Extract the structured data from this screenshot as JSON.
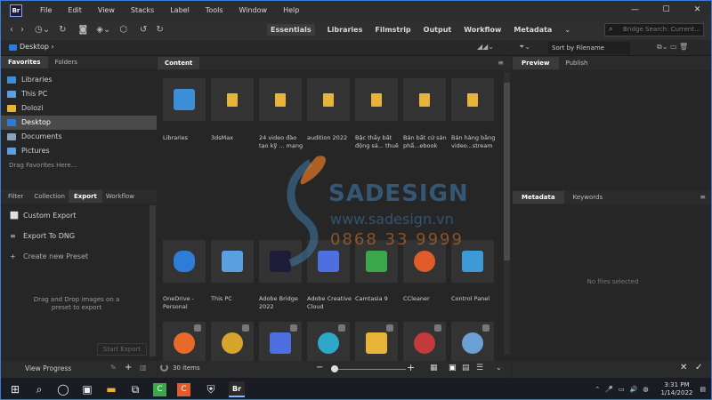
{
  "menu": {
    "items": [
      "File",
      "Edit",
      "View",
      "Stacks",
      "Label",
      "Tools",
      "Window",
      "Help"
    ],
    "logo": "Br"
  },
  "window": {
    "minimize": "—",
    "maximize": "☐",
    "close": "✕"
  },
  "toolbar": {
    "workspaces": [
      {
        "label": "Essentials",
        "active": true
      },
      {
        "label": "Libraries"
      },
      {
        "label": "Filmstrip"
      },
      {
        "label": "Output"
      },
      {
        "label": "Workflow"
      },
      {
        "label": "Metadata"
      }
    ],
    "workspace_menu": "⌄",
    "search_placeholder": "Bridge Search: Current..."
  },
  "path": {
    "label": "Desktop",
    "chevron": "›",
    "sort": "Sort by Filename"
  },
  "left": {
    "tabs": [
      "Favorites",
      "Folders"
    ],
    "favorites": [
      {
        "label": "Libraries",
        "color": "#3c8fd6"
      },
      {
        "label": "This PC",
        "color": "#5aa0e0"
      },
      {
        "label": "Dolozi",
        "color": "#e8b437"
      },
      {
        "label": "Desktop",
        "color": "#2c7cd6",
        "selected": true
      },
      {
        "label": "Documents",
        "color": "#8aa4c0"
      },
      {
        "label": "Pictures",
        "color": "#5aa0e0"
      }
    ],
    "drag_hint": "Drag Favorites Here...",
    "lower_tabs": [
      "Filter",
      "Collection",
      "Export",
      "Workflow"
    ],
    "export_items": [
      {
        "icon": "⬜",
        "label": "Custom Export"
      },
      {
        "icon": "≡",
        "label": "Export To DNG"
      },
      {
        "icon": "+",
        "label": "Create new Preset"
      }
    ],
    "drop_text": "Drag and Drop images on a preset to export",
    "start_export": "Start Export",
    "view_progress": "View Progress"
  },
  "content": {
    "tab": "Content",
    "items": [
      {
        "label": "Libraries",
        "kind": "lib"
      },
      {
        "label": "3dsMax",
        "kind": "folder"
      },
      {
        "label": "24 video đào tạo kỹ ... mạng",
        "kind": "folder"
      },
      {
        "label": "audition 2022",
        "kind": "folder"
      },
      {
        "label": "Bậc thầy bất động sả... thuê",
        "kind": "folder"
      },
      {
        "label": "Bán bất cứ sản phẩ...ebook",
        "kind": "folder"
      },
      {
        "label": "Bán hàng bằng video...stream",
        "kind": "folder"
      },
      {
        "label": "OneDrive - Personal",
        "kind": "onedrive"
      },
      {
        "label": "This PC",
        "kind": "pc"
      },
      {
        "label": "Adobe Bridge 2022",
        "kind": "bridge"
      },
      {
        "label": "Adobe Creative Cloud",
        "kind": "cc"
      },
      {
        "label": "Camtasia 9",
        "kind": "camtasia"
      },
      {
        "label": "CCleaner",
        "kind": "ccleaner"
      },
      {
        "label": "Control Panel",
        "kind": "control"
      },
      {
        "label": "",
        "kind": "firefox"
      },
      {
        "label": "",
        "kind": "chrome"
      },
      {
        "label": "",
        "kind": "shortcut"
      },
      {
        "label": "",
        "kind": "edge"
      },
      {
        "label": "",
        "kind": "paint"
      },
      {
        "label": "",
        "kind": "record"
      },
      {
        "label": "",
        "kind": "app"
      }
    ],
    "count": "30 items"
  },
  "right": {
    "top_tabs": [
      "Preview",
      "Publish"
    ],
    "bottom_tabs": [
      "Metadata",
      "Keywords"
    ],
    "empty": "No files selected"
  },
  "watermark": {
    "brand": "SADESIGN",
    "url": "www.sadesign.vn",
    "phone": "0868 33 9999"
  },
  "taskbar": {
    "time": "3:31 PM",
    "date": "1/14/2022",
    "apps": [
      "start",
      "search",
      "task",
      "files",
      "store",
      "camtasia",
      "ccleaner",
      "defender",
      "bridge"
    ]
  }
}
